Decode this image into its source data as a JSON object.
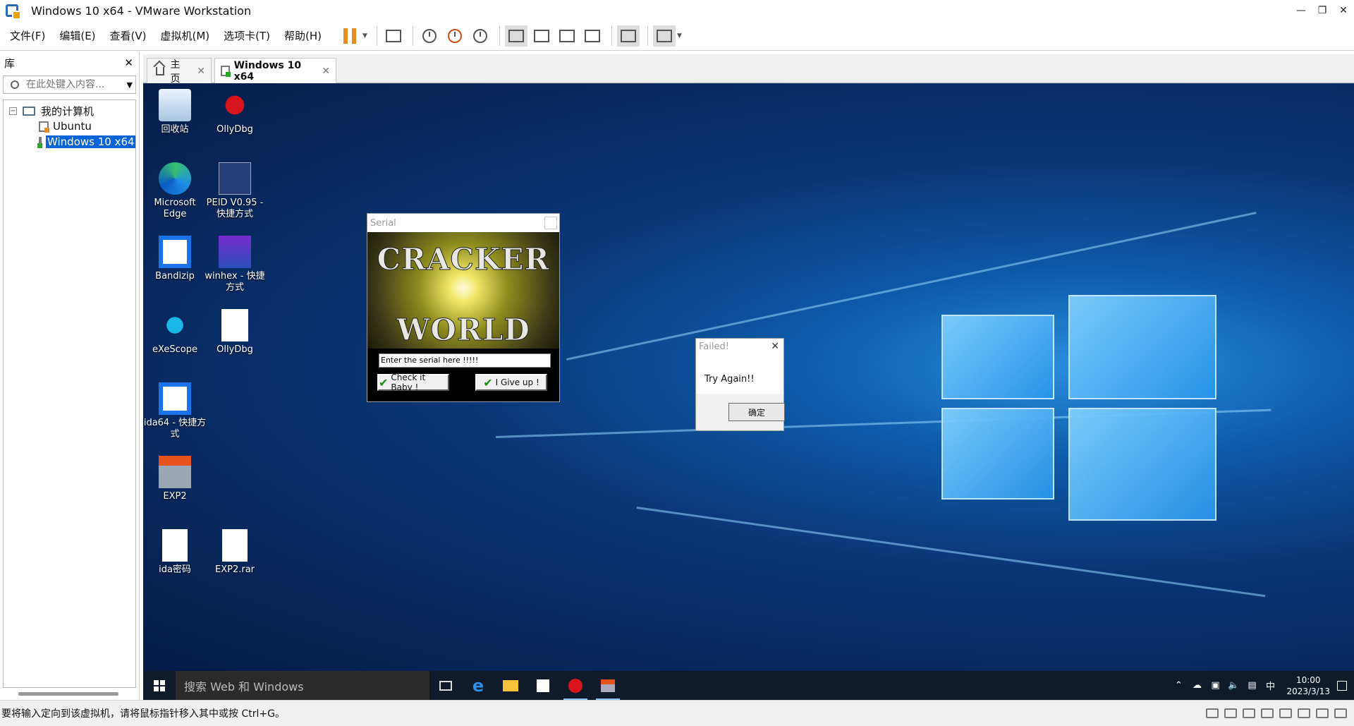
{
  "window": {
    "title": "Windows 10 x64 - VMware Workstation"
  },
  "menu": [
    "文件(F)",
    "编辑(E)",
    "查看(V)",
    "虚拟机(M)",
    "选项卡(T)",
    "帮助(H)"
  ],
  "library": {
    "title": "库",
    "search_placeholder": "在此处键入内容...",
    "tree": {
      "root": "我的计算机",
      "vm1": "Ubuntu",
      "vm2": "Windows 10 x64"
    }
  },
  "tabs": {
    "home": "主页",
    "vm": "Windows 10 x64"
  },
  "desktop_icons": {
    "recycle": "回收站",
    "ollydbg1": "OllyDbg",
    "edge": "Microsoft Edge",
    "peid": "PEID V0.95 - 快捷方式",
    "bandizip": "Bandizip",
    "winhex": "winhex - 快捷方式",
    "exescope": "eXeScope",
    "ollydbg2": "OllyDbg",
    "ida64": "ida64 - 快捷方式",
    "exp2": "EXP2",
    "idapw": "ida密码",
    "exp2rar": "EXP2.rar"
  },
  "serial_dialog": {
    "title": "Serial",
    "banner_top": "CRACKER",
    "banner_bottom": "WORLD",
    "input_value": "Enter the serial here !!!!!",
    "check_button": "Check it Baby !",
    "giveup_button": "I Give up !"
  },
  "failed_dialog": {
    "title": "Failed!",
    "message": "Try Again!!",
    "ok": "确定"
  },
  "taskbar": {
    "search_placeholder": "搜索 Web 和 Windows",
    "ime": "中",
    "time": "10:00",
    "date": "2023/3/13"
  },
  "status": {
    "text": "要将输入定向到该虚拟机，请将鼠标指针移入其中或按 Ctrl+G。"
  },
  "colors": {
    "accent": "#0a64d6",
    "pause": "#e98b1d",
    "taskbar": "#0f1a2a"
  }
}
